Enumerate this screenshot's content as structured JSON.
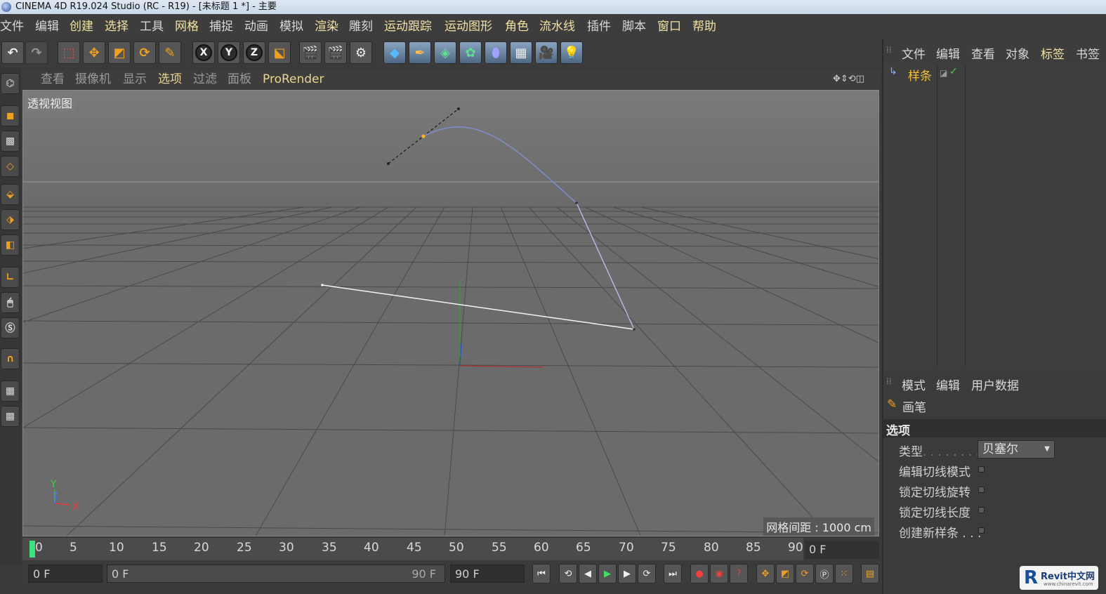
{
  "title_bar": {
    "title": "CINEMA 4D R19.024 Studio (RC - R19) - [未标题 1 *] - 主要"
  },
  "menu": {
    "items": [
      {
        "label": "文件"
      },
      {
        "label": "编辑"
      },
      {
        "label": "创建"
      },
      {
        "label": "选择"
      },
      {
        "label": "工具"
      },
      {
        "label": "网格"
      },
      {
        "label": "捕捉"
      },
      {
        "label": "动画"
      },
      {
        "label": "模拟"
      },
      {
        "label": "渲染"
      },
      {
        "label": "雕刻"
      },
      {
        "label": "运动跟踪"
      },
      {
        "label": "运动图形"
      },
      {
        "label": "角色"
      },
      {
        "label": "流水线"
      },
      {
        "label": "插件"
      },
      {
        "label": "脚本"
      },
      {
        "label": "窗口"
      },
      {
        "label": "帮助"
      }
    ]
  },
  "toolbar": {
    "x": "X",
    "y": "Y",
    "z": "Z"
  },
  "viewport": {
    "menu": [
      {
        "label": "查看"
      },
      {
        "label": "摄像机"
      },
      {
        "label": "显示"
      },
      {
        "label": "选项"
      },
      {
        "label": "过滤"
      },
      {
        "label": "面板"
      },
      {
        "label": "ProRender"
      }
    ],
    "view_name": "透视视图",
    "grid_spacing": "网格间距 : 1000 cm",
    "axis": {
      "x": "X",
      "y": "Y",
      "z": "Z"
    }
  },
  "timeline": {
    "ticks": [
      "0",
      "5",
      "10",
      "15",
      "20",
      "25",
      "30",
      "35",
      "40",
      "45",
      "50",
      "55",
      "60",
      "65",
      "70",
      "75",
      "80",
      "85",
      "90"
    ],
    "current_frame": "0 F"
  },
  "transport": {
    "start_field": "0 F",
    "range_start": "0 F",
    "range_end": "90 F",
    "end_field": "90 F"
  },
  "object_manager": {
    "menu": [
      {
        "label": "文件"
      },
      {
        "label": "编辑"
      },
      {
        "label": "查看"
      },
      {
        "label": "对象"
      },
      {
        "label": "标签"
      },
      {
        "label": "书签"
      }
    ],
    "objects": [
      {
        "name": "样条"
      }
    ]
  },
  "attribute_manager": {
    "menu": [
      {
        "label": "模式"
      },
      {
        "label": "编辑"
      },
      {
        "label": "用户数据"
      }
    ],
    "tool_name": "画笔",
    "section": "选项",
    "type_label": "类型",
    "type_value": "贝塞尔",
    "options": [
      {
        "label": "编辑切线模式"
      },
      {
        "label": "锁定切线旋转"
      },
      {
        "label": "锁定切线长度"
      },
      {
        "label": "创建新样条 . . ."
      }
    ]
  },
  "watermark": {
    "brand": "Revit中文网",
    "url": "www.chinarevit.com",
    "logo_letter": "R"
  },
  "colors": {
    "accent_yellow": "#f0e2a0",
    "viewport_bg": "#6b6b6b",
    "spline": "#9aa9e6",
    "panel": "#3d3d3d"
  }
}
